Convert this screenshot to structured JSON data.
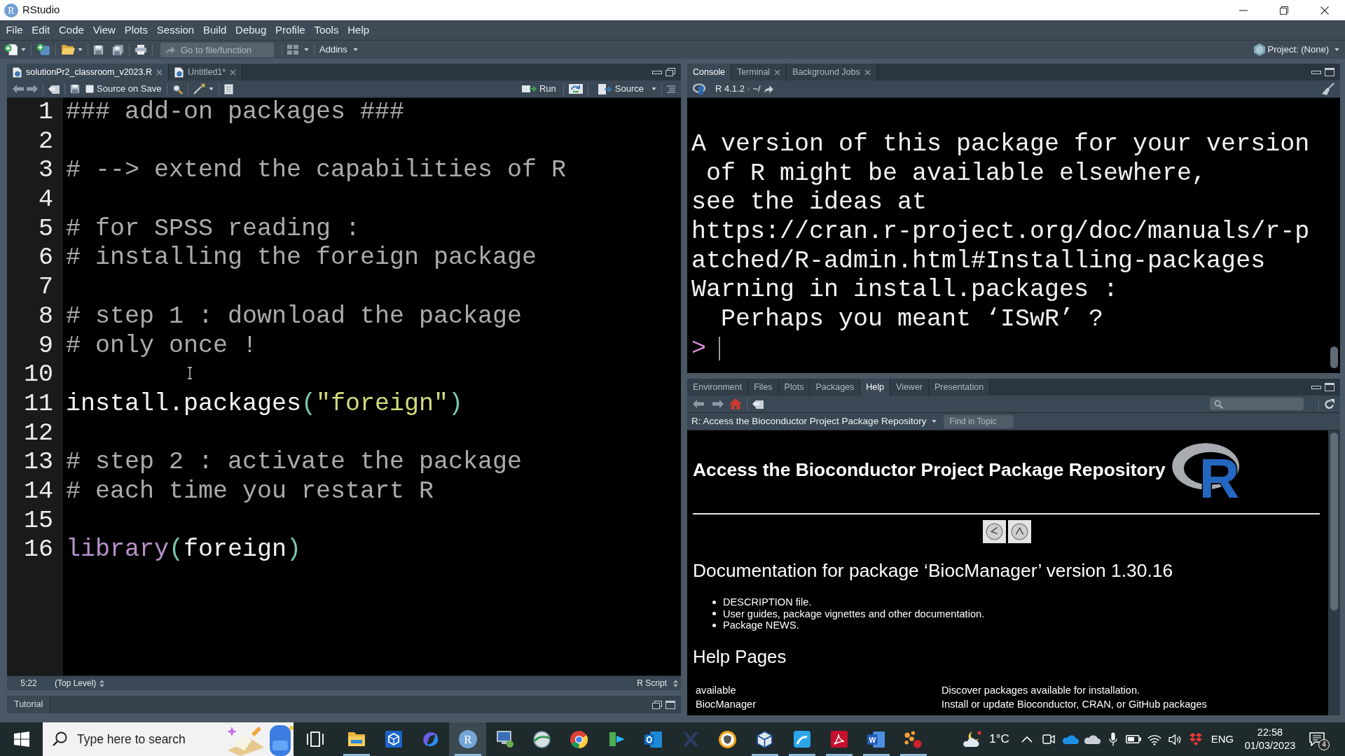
{
  "window": {
    "title": "RStudio",
    "icon_glyph": "R"
  },
  "menu": [
    "File",
    "Edit",
    "Code",
    "View",
    "Plots",
    "Session",
    "Build",
    "Debug",
    "Profile",
    "Tools",
    "Help"
  ],
  "toolbar": {
    "goto_placeholder": "Go to file/function",
    "addins": "Addins",
    "project": "Project: (None)"
  },
  "editor": {
    "tabs": [
      {
        "label": "solutionPr2_classroom_v2023.R",
        "selected": true
      },
      {
        "label": "Untitled1*",
        "selected": false
      }
    ],
    "source_on_save": {
      "label": "Source on Save",
      "checked": false
    },
    "run": "Run",
    "source": "Source",
    "lines": [
      {
        "number": "1",
        "tokens": [
          {
            "kind": "comment",
            "text": "### add-on packages ###"
          }
        ]
      },
      {
        "number": "2"
      },
      {
        "number": "3",
        "tokens": [
          {
            "kind": "comment",
            "text": "# --> extend the capabilities of R"
          }
        ]
      },
      {
        "number": "4"
      },
      {
        "number": "5",
        "tokens": [
          {
            "kind": "comment",
            "text": "# for SPSS reading :"
          }
        ]
      },
      {
        "number": "6",
        "tokens": [
          {
            "kind": "comment",
            "text": "# installing the foreign package"
          }
        ]
      },
      {
        "number": "7"
      },
      {
        "number": "8",
        "tokens": [
          {
            "kind": "comment",
            "text": "# step 1 : download the package"
          }
        ]
      },
      {
        "number": "9",
        "tokens": [
          {
            "kind": "comment",
            "text": "# only once !"
          }
        ]
      },
      {
        "number": "10"
      },
      {
        "number": "11",
        "tokens": [
          {
            "kind": "plain",
            "text": "install.packages"
          },
          {
            "kind": "paren",
            "text": "("
          },
          {
            "kind": "string",
            "text": "\"foreign\""
          },
          {
            "kind": "paren",
            "text": ")"
          }
        ]
      },
      {
        "number": "12"
      },
      {
        "number": "13",
        "tokens": [
          {
            "kind": "comment",
            "text": "# step 2 : activate the package"
          }
        ]
      },
      {
        "number": "14",
        "tokens": [
          {
            "kind": "comment",
            "text": "# each time you restart R"
          }
        ]
      },
      {
        "number": "15"
      },
      {
        "number": "16",
        "tokens": [
          {
            "kind": "function",
            "text": "library"
          },
          {
            "kind": "paren",
            "text": "("
          },
          {
            "kind": "plain",
            "text": "foreign"
          },
          {
            "kind": "paren",
            "text": ")"
          }
        ]
      }
    ],
    "status": {
      "position": "5:22",
      "scope": "(Top Level)",
      "file_type": "R Script"
    }
  },
  "tutorial": {
    "label": "Tutorial"
  },
  "console": {
    "tabs": [
      {
        "label": "Console",
        "selected": true,
        "closable": false
      },
      {
        "label": "Terminal",
        "selected": false,
        "closable": true
      },
      {
        "label": "Background Jobs",
        "selected": false,
        "closable": true
      }
    ],
    "path_label": "R 4.1.2 · ~/",
    "lines": [
      "A version of this package for your version",
      " of R might be available elsewhere,",
      "see the ideas at",
      "https://cran.r-project.org/doc/manuals/r-p",
      "atched/R-admin.html#Installing-packages",
      "Warning in install.packages :",
      "  Perhaps you meant ‘ISwR’ ?"
    ],
    "prompt": ">"
  },
  "help": {
    "tabs": [
      {
        "label": "Environment",
        "selected": false
      },
      {
        "label": "Files",
        "selected": false
      },
      {
        "label": "Plots",
        "selected": false
      },
      {
        "label": "Packages",
        "selected": false
      },
      {
        "label": "Help",
        "selected": true
      },
      {
        "label": "Viewer",
        "selected": false
      },
      {
        "label": "Presentation",
        "selected": false
      }
    ],
    "topic": "R: Access the Bioconductor Project Package Repository",
    "find_placeholder": "Find in Topic",
    "title": "Access the Bioconductor Project Package Repository",
    "logo_text": "R",
    "doc_heading": "Documentation for package ‘BiocManager’ version 1.30.16",
    "links": [
      {
        "text": "DESCRIPTION file",
        "suffix": "."
      },
      {
        "text": "User guides, package vignettes and other documentation."
      },
      {
        "text": "Package NEWS",
        "suffix": "."
      }
    ],
    "pages_heading": "Help Pages",
    "pages": [
      {
        "name": "available",
        "description": "Discover packages available for installation."
      },
      {
        "name": "BiocManager",
        "description": "Install or update Bioconductor, CRAN, or GitHub packages"
      }
    ]
  },
  "taskbar": {
    "search_placeholder": "Type here to search",
    "apps": [
      {
        "kind": "task-view",
        "running": false,
        "active": false
      },
      {
        "kind": "file-explorer",
        "running": true,
        "active": false
      },
      {
        "kind": "hex-app",
        "running": false,
        "active": false
      },
      {
        "kind": "swirl-app",
        "running": false,
        "active": false
      },
      {
        "kind": "rstudio",
        "glyph": "R",
        "running": true,
        "active": true
      },
      {
        "kind": "remote-desktop",
        "running": false,
        "active": false
      },
      {
        "kind": "globe-app",
        "running": false,
        "active": false
      },
      {
        "kind": "browser",
        "running": false,
        "active": false
      },
      {
        "kind": "green-app",
        "running": false,
        "active": false
      },
      {
        "kind": "mail",
        "running": false,
        "active": false
      },
      {
        "kind": "x-app",
        "running": false,
        "active": false
      },
      {
        "kind": "shield-app",
        "running": false,
        "active": false
      },
      {
        "kind": "cube-app",
        "running": true,
        "active": false
      },
      {
        "kind": "fiddler",
        "running": true,
        "active": false
      },
      {
        "kind": "pdf",
        "running": true,
        "active": false
      },
      {
        "kind": "word",
        "glyph": "W",
        "running": true,
        "active": false
      },
      {
        "kind": "dots-app",
        "running": true,
        "active": false
      }
    ],
    "temperature": "1°C",
    "language": "ENG",
    "time": "22:58",
    "date": "01/03/2023",
    "notifications": "4"
  }
}
